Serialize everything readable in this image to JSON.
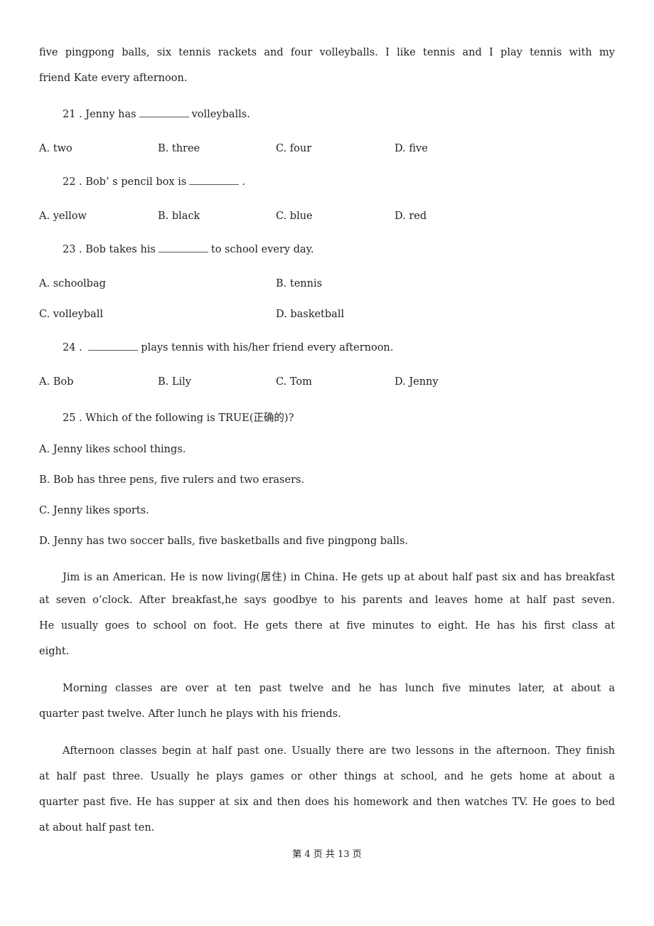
{
  "passage1_tail": {
    "lines": [
      "five pingpong balls, six tennis rackets and four volleyballs. I like tennis and I play tennis with my",
      "friend Kate every afternoon."
    ]
  },
  "questions": [
    {
      "number": "21 .",
      "before_blank": "Jenny has",
      "after_blank": "volleyballs.",
      "options": [
        "A. two",
        "B. three",
        "C. four",
        "D. five"
      ]
    },
    {
      "number": "22 .",
      "before_blank": "Bob’ s pencil box is",
      "after_blank": ".",
      "options": [
        "A. yellow",
        "B. black",
        "C. blue",
        "D. red"
      ]
    },
    {
      "number": "23 .",
      "before_blank": "Bob takes his",
      "after_blank": "to school every day.",
      "options": [
        "A. schoolbag",
        "B. tennis",
        "C. volleyball",
        "D. basketball"
      ]
    },
    {
      "number": "24 .",
      "before_blank": "",
      "after_blank": "plays tennis with his/her friend every afternoon.",
      "options": [
        "A. Bob",
        "B. Lily",
        "C. Tom",
        "D. Jenny"
      ]
    },
    {
      "number": "25 .",
      "text": "Which of the following is TRUE(正确的)?",
      "options": [
        "A. Jenny likes school things.",
        "B. Bob has three pens, five rulers and two erasers.",
        "C. Jenny likes sports.",
        "D. Jenny has two soccer balls, five basketballs and five pingpong balls."
      ]
    }
  ],
  "passage2": {
    "paragraphs": [
      [
        "Jim is an American. He is now living(居住) in China. He gets up at about half past six and has breakfast",
        "at seven o’clock. After breakfast,he says goodbye to his parents and leaves home at half past seven.",
        "He usually goes to school on foot. He gets there at five minutes to eight. He has his first class at",
        "eight."
      ],
      [
        "Morning classes are over at ten past twelve and he has lunch five minutes later, at about a",
        "quarter past twelve. After lunch he plays with his friends."
      ],
      [
        "Afternoon classes begin at half past one. Usually there are two lessons in the afternoon. They finish",
        "at half past three. Usually he plays games or other things at school, and he gets home at about a",
        "quarter past five. He has supper at six and then does his homework and then watches TV. He goes to bed",
        "at about half past ten."
      ]
    ]
  },
  "footer": {
    "page_label": "第 4 页 共 13 页"
  }
}
